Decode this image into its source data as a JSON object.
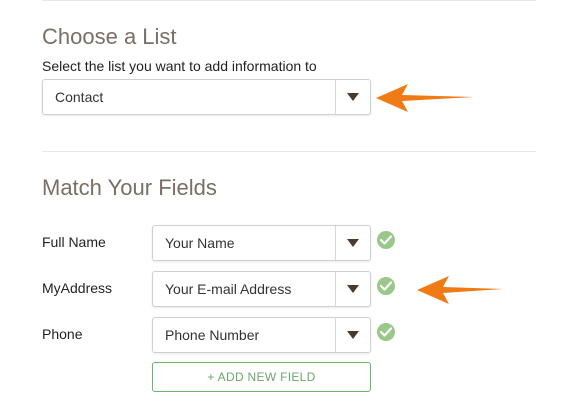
{
  "list_section": {
    "title": "Choose a List",
    "subtitle": "Select the list you want to add information to",
    "selected": "Contact"
  },
  "fields_section": {
    "title": "Match Your Fields",
    "rows": [
      {
        "label": "Full Name",
        "value": "Your Name"
      },
      {
        "label": "MyAddress",
        "value": "Your E-mail Address"
      },
      {
        "label": "Phone",
        "value": "Phone Number"
      }
    ],
    "add_button": "+ ADD NEW FIELD"
  },
  "colors": {
    "heading": "#7a6e66",
    "check": "#9ac88a",
    "add_button": "#6bb56b",
    "pointer_arrow": "#f07a14"
  },
  "icons": [
    "chevron-down-icon",
    "check-circle-icon",
    "orange-pointer-arrow-icon"
  ]
}
